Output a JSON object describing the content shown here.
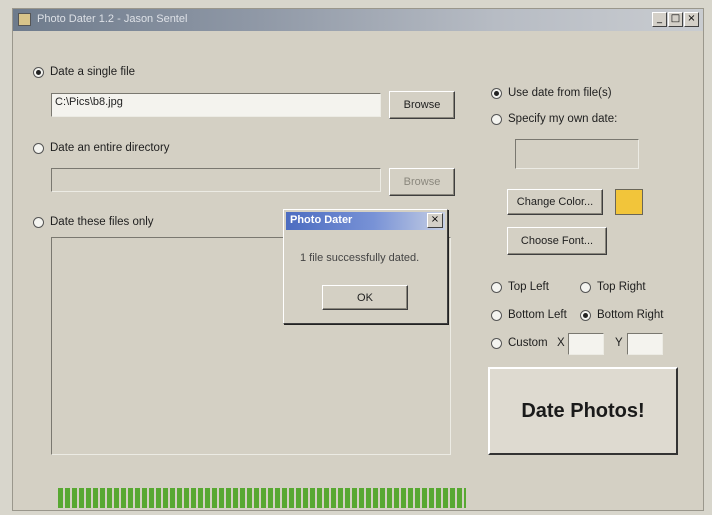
{
  "window": {
    "title": "Photo Dater 1.2 - Jason Sentel",
    "minimize_glyph": "_",
    "maximize_glyph": "□",
    "close_glyph": "×"
  },
  "source": {
    "single_file_label": "Date a single file",
    "single_file_selected": true,
    "single_file_value": "C:\\Pics\\b8.jpg",
    "browse_label": "Browse",
    "directory_label": "Date an entire directory",
    "directory_selected": false,
    "directory_value": "",
    "directory_browse_label": "Browse",
    "files_only_label": "Date these files only",
    "files_only_selected": false
  },
  "date_options": {
    "from_file_label": "Use date from file(s)",
    "from_file_selected": true,
    "own_date_label": "Specify my own date:",
    "own_date_selected": false,
    "own_date_value": ""
  },
  "appearance": {
    "change_color_label": "Change Color...",
    "choose_font_label": "Choose Font...",
    "color": "#f2c53a"
  },
  "position": {
    "top_left_label": "Top Left",
    "top_right_label": "Top Right",
    "bottom_left_label": "Bottom Left",
    "bottom_right_label": "Bottom Right",
    "custom_label": "Custom",
    "x_label": "X",
    "y_label": "Y",
    "selected": "Bottom Right",
    "x_value": "",
    "y_value": ""
  },
  "actions": {
    "date_photos_label": "Date Photos!"
  },
  "progress": {
    "fraction": 0.62
  },
  "dialog": {
    "title": "Photo Dater",
    "close_glyph": "×",
    "message": "1 file successfully dated.",
    "ok_label": "OK"
  },
  "colors": {
    "progress": "#58a832",
    "dialog_title": "#4c6cc0",
    "swatch": "#f2c53a"
  }
}
